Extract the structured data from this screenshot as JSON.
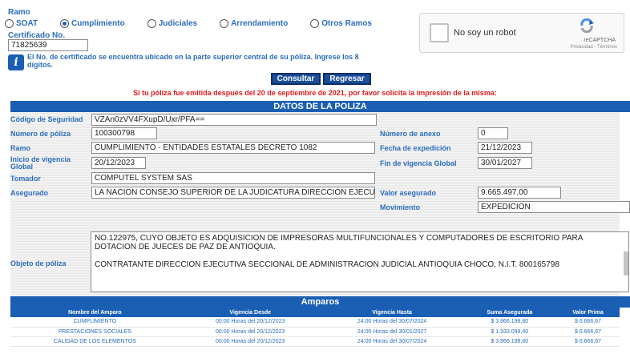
{
  "ramo_label": "Ramo",
  "radios": [
    {
      "label": "SOAT",
      "selected": false
    },
    {
      "label": "Cumplimiento",
      "selected": true
    },
    {
      "label": "Judiciales",
      "selected": false
    },
    {
      "label": "Arrendamiento",
      "selected": false
    },
    {
      "label": "Otros Ramos",
      "selected": false
    }
  ],
  "certificado": {
    "label": "Certificado No.",
    "value": "71825639"
  },
  "info_text": "El No. de certificado se encuentra ubicado en la parte superior central de su póliza. Ingrese los 8 dígitos.",
  "captcha": {
    "label": "No soy un robot",
    "brand": "reCAPTCHA",
    "terms": "Privacidad - Términos"
  },
  "buttons": {
    "consultar": "Consultar",
    "regresar": "Regresar"
  },
  "warning": "Si tu póliza fue emitida después del 20 de septiembre de 2021, por favor solicita la impresión de la misma:",
  "datos_title": "DATOS DE LA POLIZA",
  "fields": {
    "codigo_seguridad": {
      "label": "Código de Seguridad",
      "value": "VZAn0zVV4FXupD/Uxr/PFA=="
    },
    "numero_poliza": {
      "label": "Número de póliza",
      "value": "100300798"
    },
    "numero_anexo": {
      "label": "Número de anexo",
      "value": "0"
    },
    "ramo": {
      "label": "Ramo",
      "value": "CUMPLIMIENTO - ENTIDADES ESTATALES DECRETO 1082"
    },
    "fecha_expedicion": {
      "label": "Fecha de expedición",
      "value": "21/12/2023"
    },
    "inicio_vigencia": {
      "label": "Inicio de vigencia Global",
      "value": "20/12/2023"
    },
    "fin_vigencia": {
      "label": "Fin de vigencia Global",
      "value": "30/01/2027"
    },
    "tomador": {
      "label": "Tomador",
      "value": "COMPUTEL SYSTEM SAS"
    },
    "asegurado": {
      "label": "Asegurado",
      "value": "LA NACION CONSEJO SUPERIOR DE LA JUDICATURA  DIRECCION EJECU"
    },
    "valor_asegurado": {
      "label": "Valor asegurado",
      "value": "9.665.497,00"
    },
    "movimiento": {
      "label": "Movimiento",
      "value": "EXPEDICION"
    },
    "objeto": {
      "label": "Objeto de póliza",
      "line1": "NO.122975, CUYO OBJETO ES ADQUISICION DE IMPRESORAS MULTIFUNCIONALES Y COMPUTADORES DE ESCRITORIO PARA DOTACION DE JUECES DE PAZ DE ANTIOQUIA.",
      "line2": "CONTRATANTE DIRECCION EJECUTIVA SECCIONAL DE ADMINISTRACION JUDICIAL ANTIOQUIA CHOCO, N.I.T. 800165798"
    }
  },
  "amparos": {
    "title": "Amparos",
    "headers": [
      "Nombre del Amparo",
      "Vigencia Desde",
      "Vigencia Hasta",
      "Suma Asegurada",
      "Valor Prima"
    ],
    "rows": [
      [
        "CUMPLIMIENTO",
        "00:00 Horas del 20/12/2023",
        "24:00 Horas del 30/07/2024",
        "$ 3.866.198,80",
        "$ 6.666,67"
      ],
      [
        "PRESTACIONES SOCIALES",
        "00:00 Horas del 20/12/2023",
        "24:00 Horas del 30/01/2027",
        "$ 1.933.099,40",
        "$ 6.666,67"
      ],
      [
        "CALIDAD DE LOS ELEMENTOS",
        "00:00 Horas del 20/12/2023",
        "24:00 Horas del 30/07/2024",
        "$ 3.866.198,80",
        "$ 6.666,67"
      ]
    ]
  }
}
